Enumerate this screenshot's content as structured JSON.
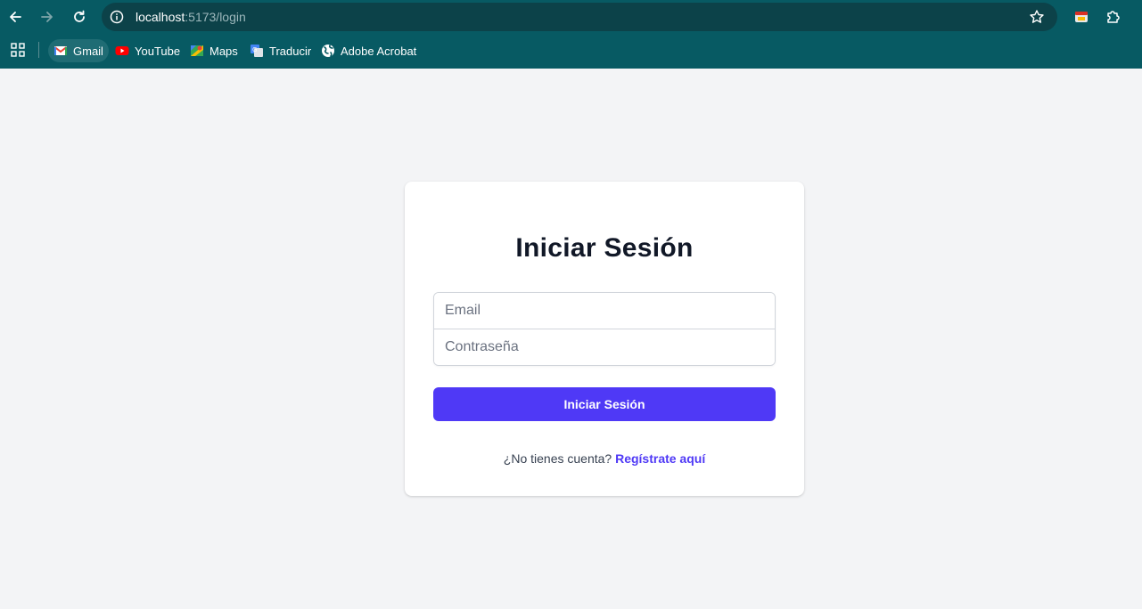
{
  "browser": {
    "url_host": "localhost",
    "url_path": ":5173/login",
    "bookmarks": [
      {
        "label": "Gmail",
        "icon": "gmail-icon"
      },
      {
        "label": "YouTube",
        "icon": "youtube-icon"
      },
      {
        "label": "Maps",
        "icon": "maps-icon"
      },
      {
        "label": "Traducir",
        "icon": "translate-icon"
      },
      {
        "label": "Adobe Acrobat",
        "icon": "globe-icon"
      }
    ]
  },
  "login": {
    "title": "Iniciar Sesión",
    "email_placeholder": "Email",
    "password_placeholder": "Contraseña",
    "submit_label": "Iniciar Sesión",
    "no_account_text": "¿No tienes cuenta?",
    "register_link": "Regístrate aquí"
  },
  "colors": {
    "chrome": "#075a63",
    "accent": "#4f39f6",
    "page_bg": "#f3f4f6"
  }
}
